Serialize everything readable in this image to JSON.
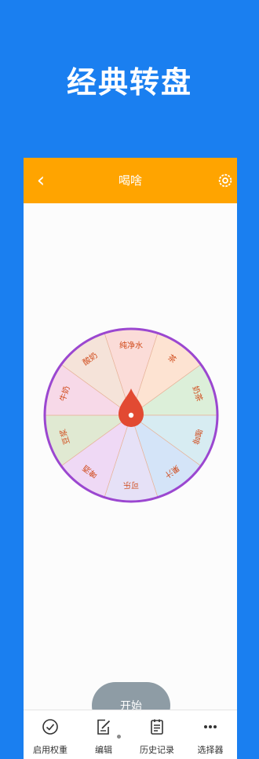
{
  "promo": {
    "title": "经典转盘"
  },
  "appbar": {
    "title": "喝啥",
    "back_icon": "chevron-left-icon",
    "settings_icon": "gear-icon"
  },
  "wheel": {
    "rim_color": "#9b47d0",
    "pointer_color": "#e24a32",
    "label_color": "#d04a1a",
    "segments": [
      {
        "label": "纯净水",
        "color": "#fbdcd8"
      },
      {
        "label": "茶",
        "color": "#fde3d2"
      },
      {
        "label": "奶茶",
        "color": "#dcefd9"
      },
      {
        "label": "咖啡",
        "color": "#d7ecf2"
      },
      {
        "label": "果汁",
        "color": "#d4e4f8"
      },
      {
        "label": "可乐",
        "color": "#e6e1f7"
      },
      {
        "label": "啤酒",
        "color": "#efd9f5"
      },
      {
        "label": "豆浆",
        "color": "#e0e9d2"
      },
      {
        "label": "牛奶",
        "color": "#f7d9e8"
      },
      {
        "label": "酸奶",
        "color": "#f5e3d9"
      }
    ]
  },
  "start_button": {
    "label": "开始"
  },
  "nav": {
    "items": [
      {
        "label": "启用权重",
        "icon": "check-circle-icon"
      },
      {
        "label": "编辑",
        "icon": "edit-icon"
      },
      {
        "label": "历史记录",
        "icon": "history-icon"
      },
      {
        "label": "选择器",
        "icon": "more-icon"
      }
    ]
  }
}
